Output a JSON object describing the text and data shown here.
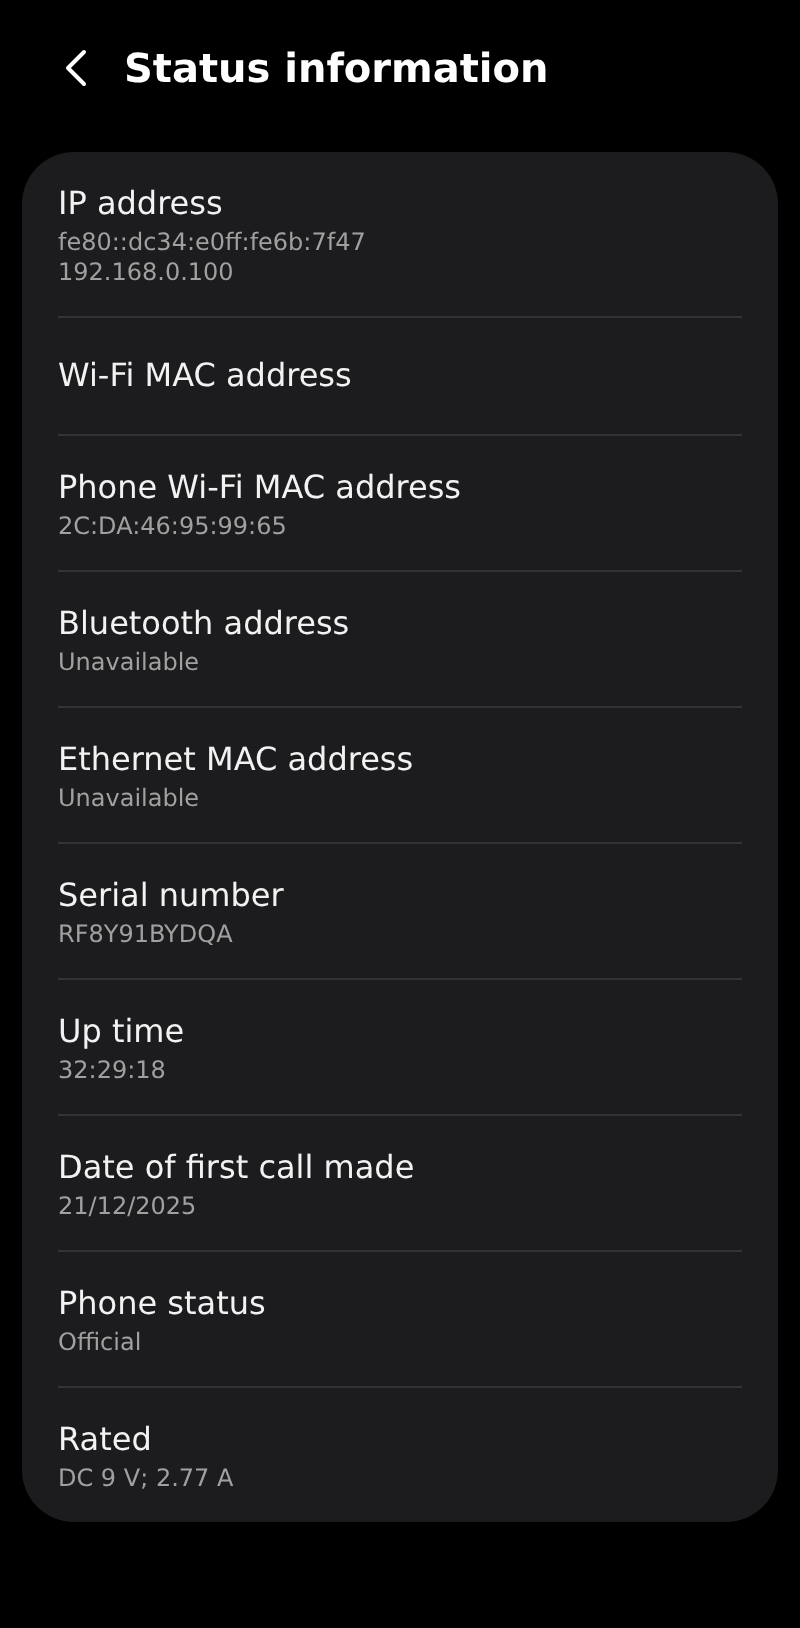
{
  "header": {
    "title": "Status information"
  },
  "items": [
    {
      "title": "IP address",
      "values": [
        "fe80::dc34:e0ff:fe6b:7f47",
        "192.168.0.100"
      ]
    },
    {
      "title": "Wi-Fi MAC address"
    },
    {
      "title": "Phone Wi-Fi MAC address",
      "values": [
        "2C:DA:46:95:99:65"
      ]
    },
    {
      "title": "Bluetooth address",
      "values": [
        "Unavailable"
      ]
    },
    {
      "title": "Ethernet MAC address",
      "values": [
        "Unavailable"
      ]
    },
    {
      "title": "Serial number",
      "values": [
        "RF8Y91BYDQA"
      ]
    },
    {
      "title": "Up time",
      "values": [
        "32:29:18"
      ]
    },
    {
      "title": "Date of first call made",
      "values": [
        "21/12/2025"
      ]
    },
    {
      "title": "Phone status",
      "values": [
        "Official"
      ]
    },
    {
      "title": "Rated",
      "values": [
        "DC 9 V; 2.77 A"
      ]
    }
  ]
}
